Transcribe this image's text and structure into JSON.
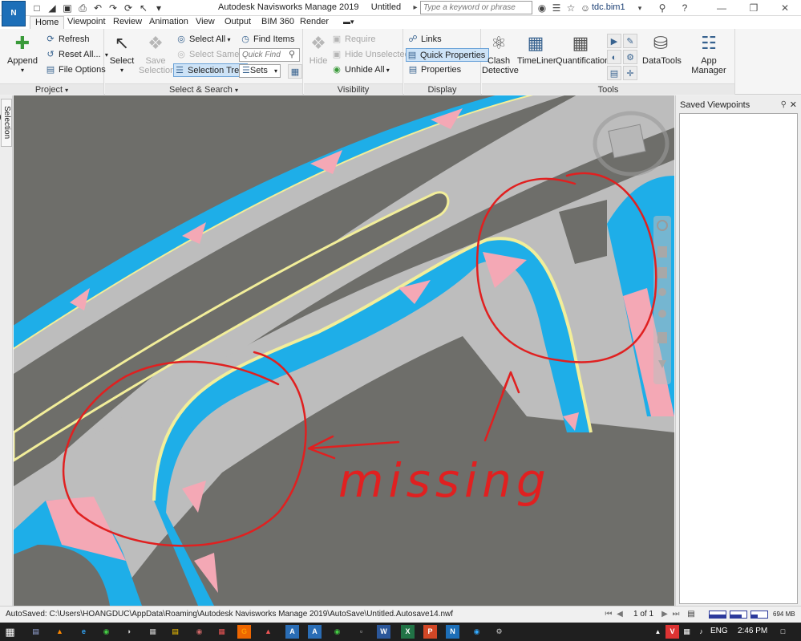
{
  "app": {
    "logo_letter": "N",
    "title": "Autodesk Navisworks Manage 2019",
    "document": "Untitled",
    "search_placeholder": "Type a keyword or phrase",
    "user": "tdc.bim1"
  },
  "tabs": [
    {
      "label": "Home",
      "active": true
    },
    {
      "label": "Viewpoint"
    },
    {
      "label": "Review"
    },
    {
      "label": "Animation"
    },
    {
      "label": "View"
    },
    {
      "label": "Output"
    },
    {
      "label": "BIM 360"
    },
    {
      "label": "Render"
    }
  ],
  "ribbon": {
    "project": {
      "title": "Project",
      "append": "Append",
      "refresh": "Refresh",
      "reset_all": "Reset All...",
      "file_options": "File Options"
    },
    "select_search": {
      "title": "Select & Search",
      "select": "Select",
      "save_selection": "Save Selection",
      "select_all": "Select All",
      "select_same": "Select Same",
      "selection_tree": "Selection Tree",
      "find_items": "Find Items",
      "quick_find_placeholder": "Quick Find",
      "sets": "Sets"
    },
    "visibility": {
      "title": "Visibility",
      "hide": "Hide",
      "require": "Require",
      "hide_unselected": "Hide Unselected",
      "unhide_all": "Unhide All"
    },
    "display": {
      "title": "Display",
      "links": "Links",
      "quick_properties": "Quick Properties",
      "properties": "Properties"
    },
    "tools": {
      "title": "Tools",
      "clash_detective": "Clash Detective",
      "timeliner": "TimeLiner",
      "quantification": "Quantification",
      "datatools": "DataTools",
      "app_manager": "App Manager"
    }
  },
  "left_strip": {
    "tab": "Selection Tree"
  },
  "viewport": {
    "annotation": "missing",
    "colors": {
      "background": "#6e6e6a",
      "road": "#bdbdbd",
      "curb": "#1eaee8",
      "edge_line": "#f2ee9a",
      "pink": "#f4a8b5",
      "annotation_red": "#e02020"
    }
  },
  "right_panel": {
    "title": "Saved Viewpoints"
  },
  "status": {
    "autosave": "AutoSaved: C:\\Users\\HOANGDUC\\AppData\\Roaming\\Autodesk Navisworks Manage 2019\\AutoSave\\Untitled.Autosave14.nwf",
    "page": "1 of 1",
    "memory": "694 MB"
  },
  "taskbar": {
    "language": "ENG",
    "time": "2:46 PM"
  }
}
